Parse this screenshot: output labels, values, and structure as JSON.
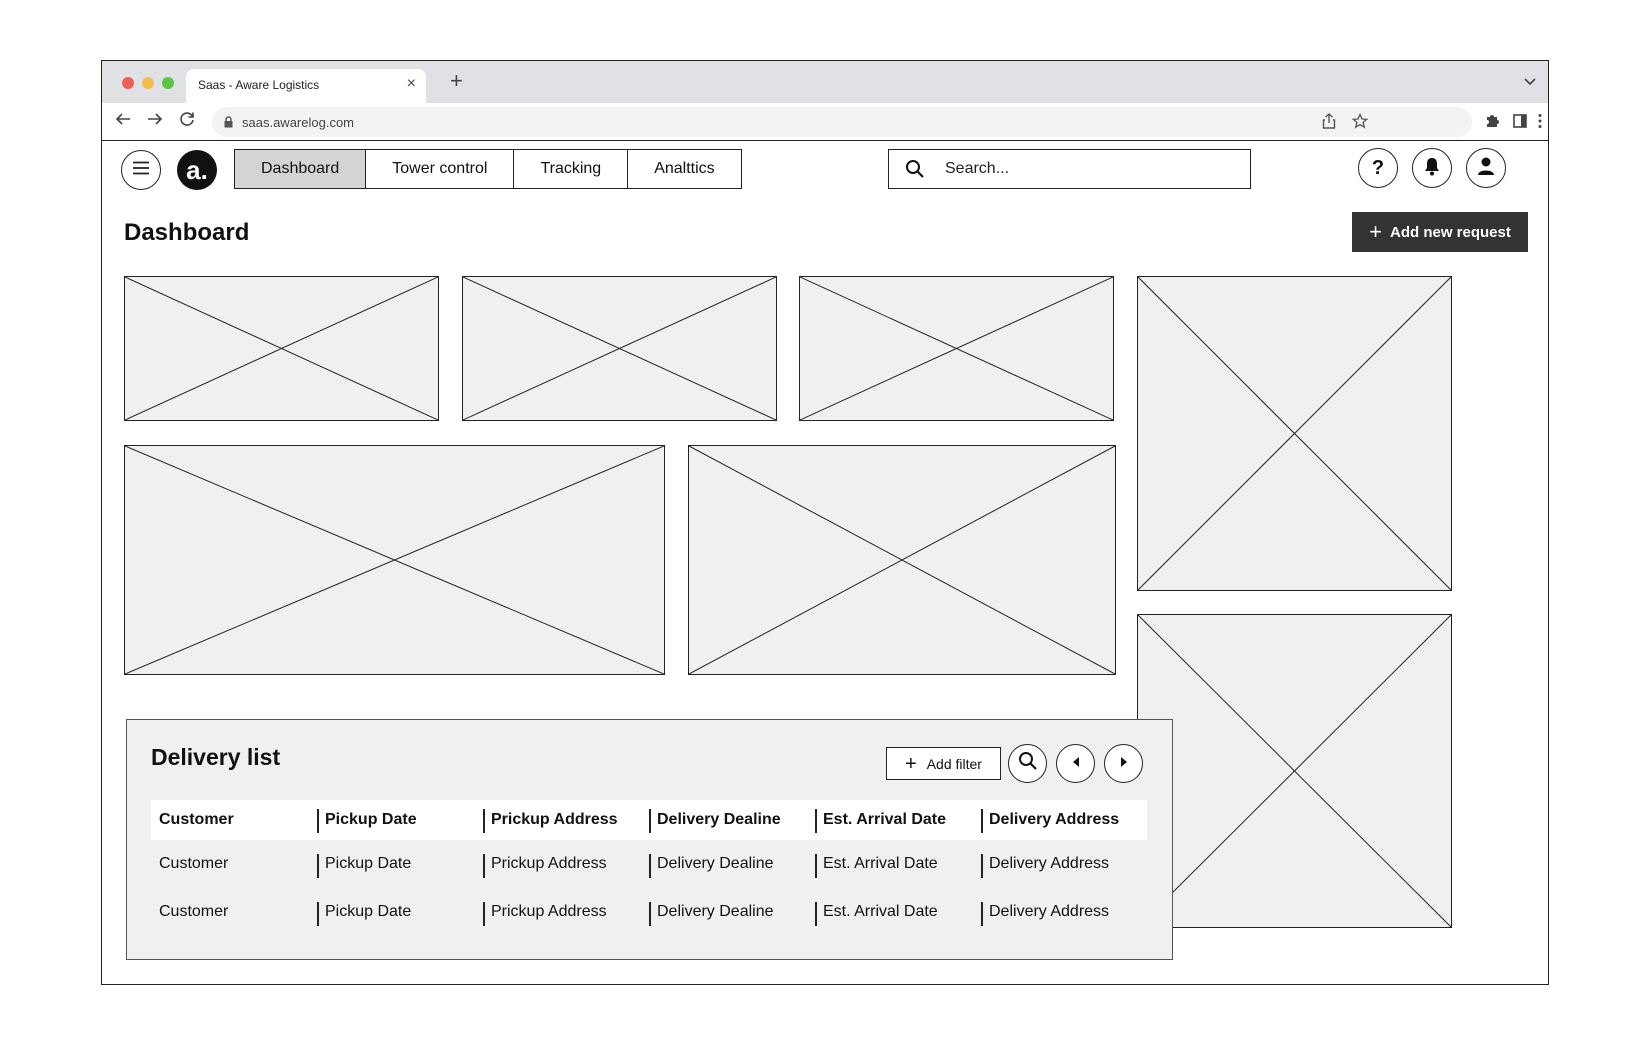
{
  "browser": {
    "tab_title": "Saas - Aware Logistics",
    "tab_close": "×",
    "new_tab": "+",
    "url": "saas.awarelog.com"
  },
  "app": {
    "logo_text": "a.",
    "nav_tabs": [
      {
        "label": "Dashboard",
        "active": true
      },
      {
        "label": "Tower control",
        "active": false
      },
      {
        "label": "Tracking",
        "active": false
      },
      {
        "label": "Analttics",
        "active": false
      }
    ],
    "search_placeholder": "Search...",
    "help_label": "?"
  },
  "page": {
    "title": "Dashboard",
    "add_request_label": "Add new request"
  },
  "delivery_list": {
    "title": "Delivery list",
    "add_filter_label": "Add filter",
    "columns": [
      "Customer",
      "Pickup Date",
      "Prickup Address",
      "Delivery Dealine",
      "Est. Arrival Date",
      "Delivery Address"
    ],
    "rows": [
      [
        "Customer",
        "Pickup Date",
        "Prickup Address",
        "Delivery Dealine",
        "Est. Arrival Date",
        "Delivery Address"
      ],
      [
        "Customer",
        "Pickup Date",
        "Prickup Address",
        "Delivery Dealine",
        "Est. Arrival Date",
        "Delivery Address"
      ]
    ]
  },
  "colors": {
    "active_tab": "#d4d4d4",
    "primary_button": "#333333",
    "placeholder_fill": "#f0f0f0"
  }
}
